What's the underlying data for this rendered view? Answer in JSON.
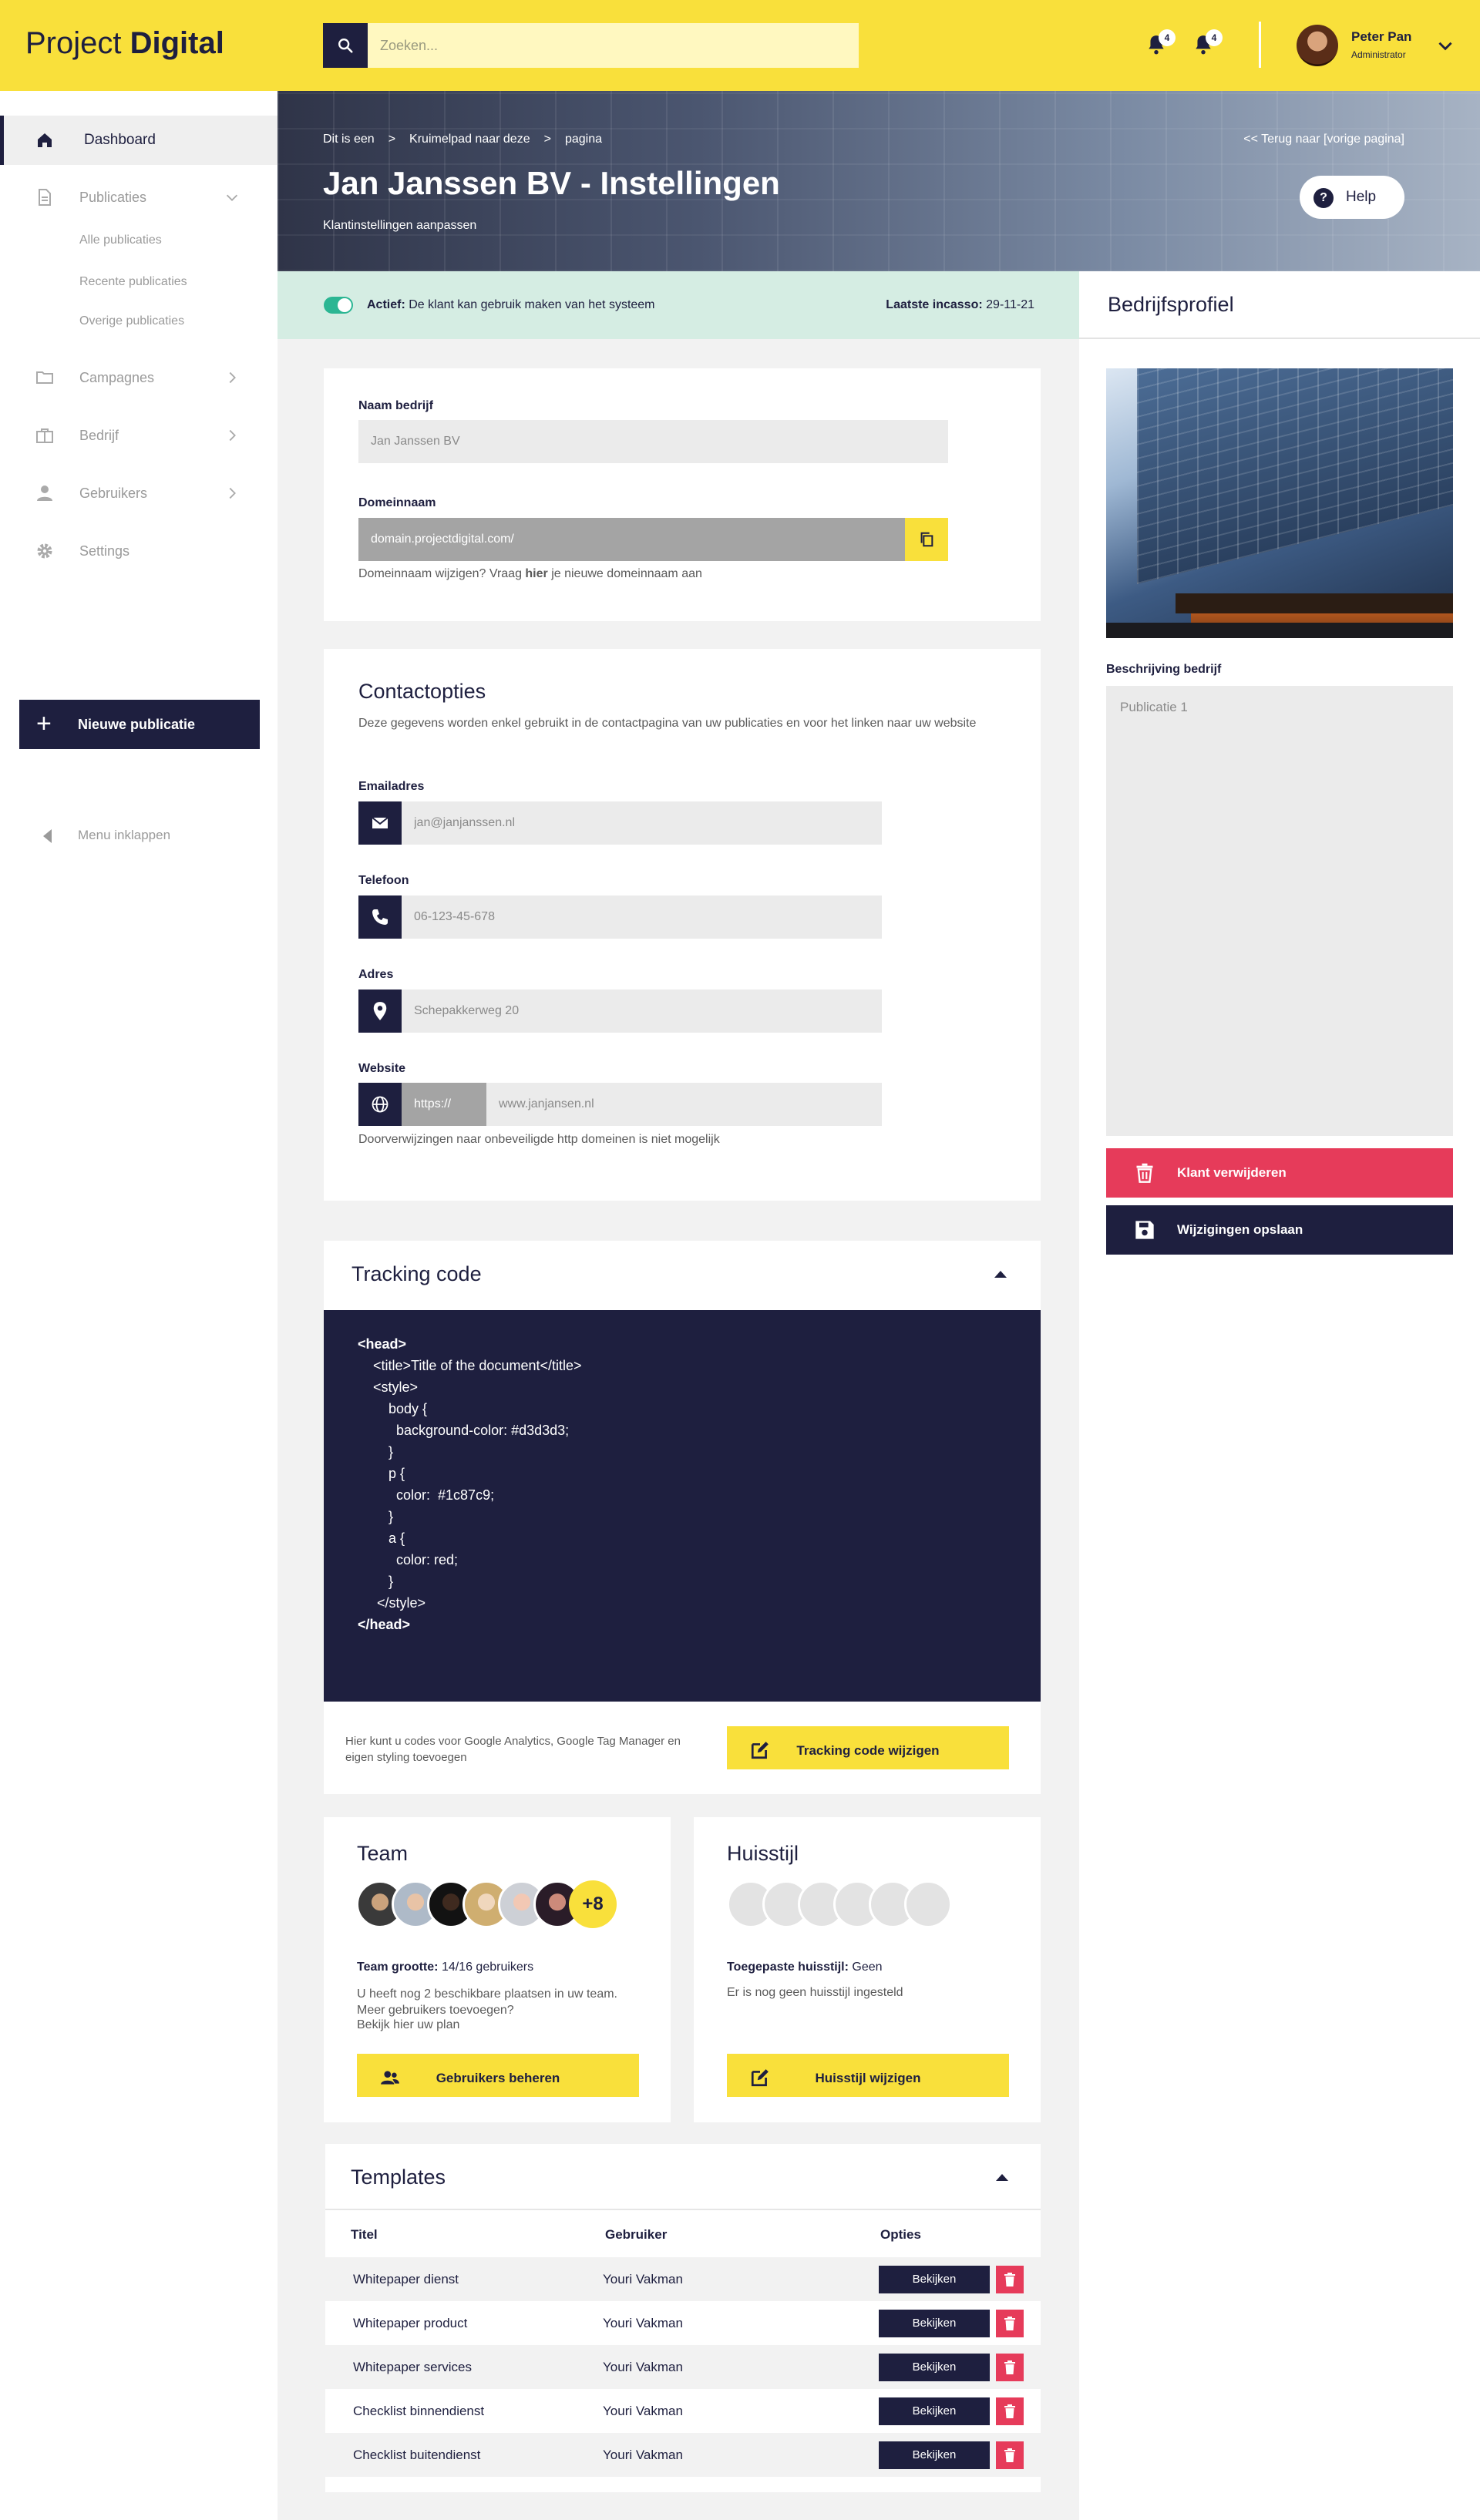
{
  "header": {
    "logo_light": "Project",
    "logo_bold": "Digital",
    "search_placeholder": "Zoeken...",
    "notifications": [
      {
        "count": "4"
      },
      {
        "count": "4"
      }
    ],
    "user": {
      "name": "Peter Pan",
      "role": "Administrator"
    }
  },
  "sidebar": {
    "items": [
      {
        "label": "Dashboard",
        "icon": "home-icon"
      },
      {
        "label": "Publicaties",
        "icon": "document-icon"
      },
      {
        "label": "Campagnes",
        "icon": "folder-icon"
      },
      {
        "label": "Bedrijf",
        "icon": "briefcase-icon"
      },
      {
        "label": "Gebruikers",
        "icon": "user-icon"
      },
      {
        "label": "Settings",
        "icon": "gear-icon"
      }
    ],
    "sub_items": [
      "Alle publicaties",
      "Recente publicaties",
      "Overige publicaties"
    ],
    "new_button": "Nieuwe publicatie",
    "collapse": "Menu inklappen"
  },
  "hero": {
    "breadcrumbs": [
      "Dit is een",
      ">",
      "Kruimelpad naar deze",
      ">",
      "pagina"
    ],
    "back_link": "<<  Terug naar [vorige pagina]",
    "title": "Jan Janssen BV - Instellingen",
    "subtitle": "Klantinstellingen aanpassen",
    "help": "Help"
  },
  "status": {
    "active_label": "Actief:",
    "active_text": "De klant kan gebruik maken van het systeem",
    "last_label": "Laatste incasso:",
    "last_value": "29-11-21",
    "active_color": "#2bb693"
  },
  "company": {
    "name_label": "Naam bedrijf",
    "name_value": "Jan Janssen BV",
    "domain_label": "Domeinnaam",
    "domain_value": "domain.projectdigital.com/",
    "domain_hint_pre": "Domeinnaam wijzigen? Vraag ",
    "domain_hint_bold": "hier",
    "domain_hint_post": " je nieuwe domeinnaam aan"
  },
  "contact": {
    "title": "Contactopties",
    "description": "Deze gegevens worden enkel gebruikt in de contactpagina van uw publicaties en voor het linken naar uw website",
    "email_label": "Emailadres",
    "email_value": "jan@janjanssen.nl",
    "phone_label": "Telefoon",
    "phone_value": "06-123-45-678",
    "address_label": "Adres",
    "address_value": "Schepakkerweg 20",
    "website_label": "Website",
    "website_prefix": "https://",
    "website_value": "www.janjansen.nl",
    "website_hint": "Doorverwijzingen naar onbeveiligde http domeinen is niet mogelijk"
  },
  "tracking": {
    "title": "Tracking code",
    "code_lines": [
      "<head>",
      "    <title>Title of the document</title>",
      "    <style>",
      "        body {",
      "          background-color: #d3d3d3;",
      "        }",
      "        p {",
      "          color:  #1c87c9;",
      "        }",
      "        a {",
      "          color: red;",
      "        }",
      "     </style>",
      "</head>"
    ],
    "hint": "Hier kunt u codes voor Google Analytics, Google Tag Manager en eigen styling toevoegen",
    "button": "Tracking code wijzigen"
  },
  "team": {
    "title": "Team",
    "more": "+8",
    "size_label": "Team grootte:",
    "size_value": "14/16 gebruikers",
    "text": "U heeft nog 2 beschikbare plaatsen in uw team. Meer gebruikers toevoegen?",
    "plan_link": "Bekijk hier uw plan",
    "button": "Gebruikers beheren"
  },
  "style": {
    "title": "Huisstijl",
    "applied_label": "Toegepaste huisstijl:",
    "applied_value": "Geen",
    "text": "Er is nog geen huisstijl ingesteld",
    "button": "Huisstijl wijzigen"
  },
  "templates": {
    "title": "Templates",
    "columns": [
      "Titel",
      "Gebruiker",
      "Opties"
    ],
    "rows": [
      {
        "title": "Whitepaper dienst",
        "user": "Youri Vakman",
        "action": "Bekijken"
      },
      {
        "title": "Whitepaper product",
        "user": "Youri Vakman",
        "action": "Bekijken"
      },
      {
        "title": "Whitepaper services",
        "user": "Youri Vakman",
        "action": "Bekijken"
      },
      {
        "title": "Checklist binnendienst",
        "user": "Youri Vakman",
        "action": "Bekijken"
      },
      {
        "title": "Checklist buitendienst",
        "user": "Youri Vakman",
        "action": "Bekijken"
      }
    ]
  },
  "profile": {
    "title": "Bedrijfsprofiel",
    "description_label": "Beschrijving bedrijf",
    "description_value": "Publicatie 1",
    "delete_button": "Klant verwijderen",
    "save_button": "Wijzigingen opslaan"
  },
  "colors": {
    "accent": "#f9e03b",
    "navy": "#1e1f3f",
    "danger": "#e63b5a",
    "success_bg": "#d5ede3"
  }
}
